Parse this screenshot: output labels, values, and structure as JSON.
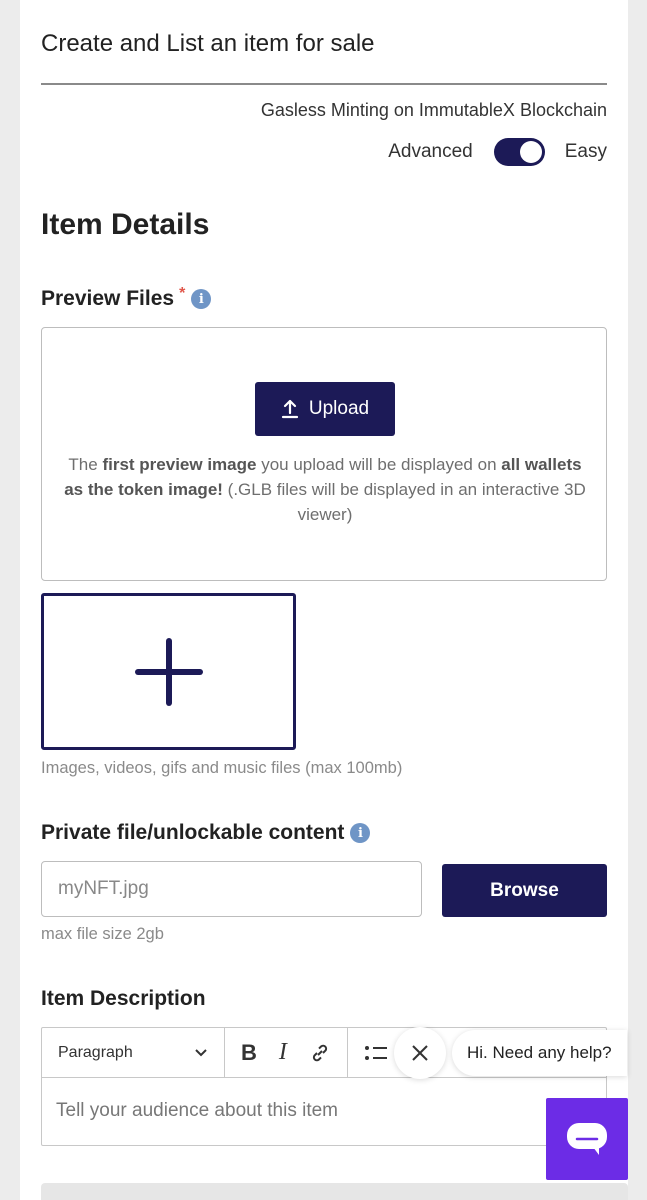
{
  "header": {
    "title": "Create and List an item for sale",
    "subtitle": "Gasless Minting on ImmutableX Blockchain",
    "mode_left": "Advanced",
    "mode_right": "Easy",
    "toggle_on": true
  },
  "item_details": {
    "heading": "Item Details"
  },
  "preview_files": {
    "label": "Preview Files",
    "required_mark": "*",
    "upload_label": "Upload",
    "help_prefix": "The ",
    "help_bold1": "first preview image",
    "help_mid": " you upload will be displayed on ",
    "help_bold2": "all wallets as the token image!",
    "help_suffix": " (.GLB files will be displayed in an interactive 3D viewer)",
    "hint": "Images, videos, gifs and music files (max 100mb)"
  },
  "private_file": {
    "label": "Private file/unlockable content",
    "input_placeholder": "myNFT.jpg",
    "browse_label": "Browse",
    "hint": "max file size 2gb"
  },
  "description": {
    "label": "Item Description",
    "paragraph_select": "Paragraph",
    "placeholder": "Tell your audience about this item"
  },
  "chat": {
    "bubble_text": "Hi. Need any help?"
  },
  "colors": {
    "primary": "#1c1a57",
    "chat": "#6c2ce6",
    "required": "#e0564a",
    "info": "#6f95c6"
  }
}
